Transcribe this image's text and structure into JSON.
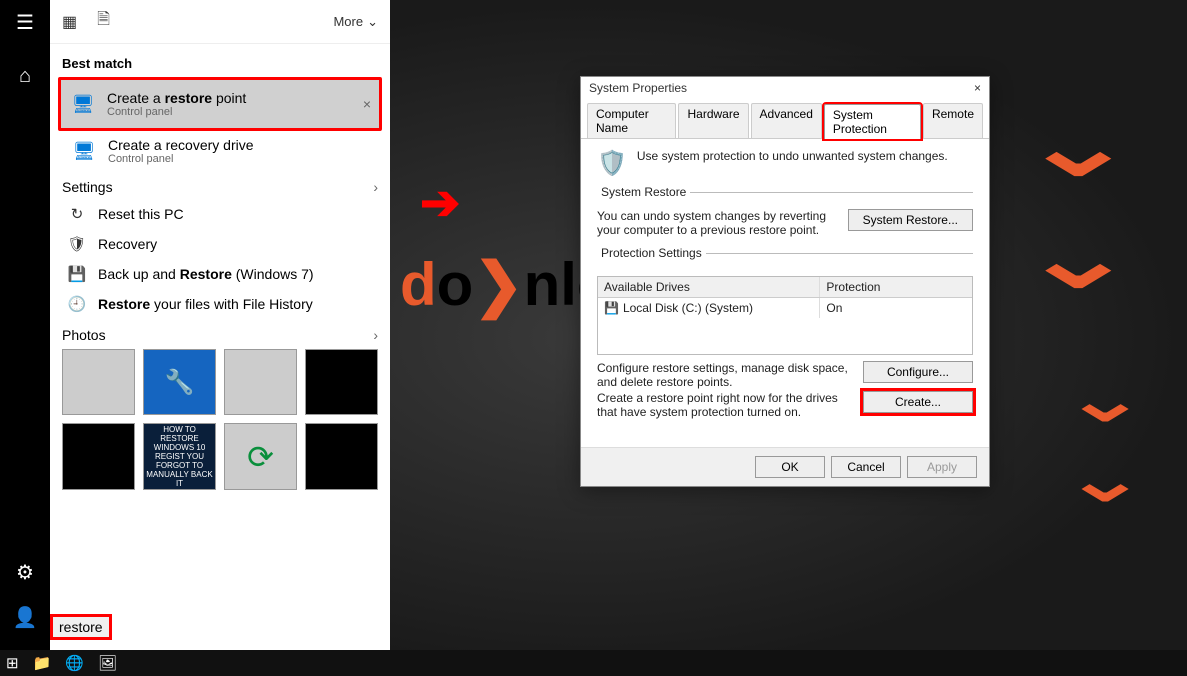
{
  "start": {
    "more": "More",
    "best_match": "Best match",
    "results": [
      {
        "title": "Create a restore point",
        "bold_word": "restore",
        "sub": "Control panel",
        "selected": true
      },
      {
        "title": "Create a recovery drive",
        "sub": "Control panel"
      }
    ],
    "settings_header": "Settings",
    "settings": [
      {
        "icon": "↻",
        "label": "Reset this PC"
      },
      {
        "icon": "🛡",
        "label": "Recovery"
      },
      {
        "icon": "💾",
        "label_pre": "Back up and ",
        "bold": "Restore",
        "label_post": " (Windows 7)"
      },
      {
        "icon": "🕘",
        "label_pre": "",
        "bold": "Restore",
        "label_post": " your files with File History"
      }
    ],
    "photos_header": "Photos",
    "search_value": "restore"
  },
  "arrow_icon": "➔",
  "sp": {
    "title": "System Properties",
    "tabs": [
      "Computer Name",
      "Hardware",
      "Advanced",
      "System Protection",
      "Remote"
    ],
    "active_tab": "System Protection",
    "intro": "Use system protection to undo unwanted system changes.",
    "restore": {
      "legend": "System Restore",
      "text": "You can undo system changes by reverting your computer to a previous restore point.",
      "button": "System Restore..."
    },
    "protection": {
      "legend": "Protection Settings",
      "col1": "Available Drives",
      "col2": "Protection",
      "drive": "Local Disk (C:) (System)",
      "status": "On",
      "configure_text": "Configure restore settings, manage disk space, and delete restore points.",
      "configure_btn": "Configure...",
      "create_text": "Create a restore point right now for the drives that have system protection turned on.",
      "create_btn": "Create..."
    },
    "buttons": {
      "ok": "OK",
      "cancel": "Cancel",
      "apply": "Apply"
    }
  }
}
